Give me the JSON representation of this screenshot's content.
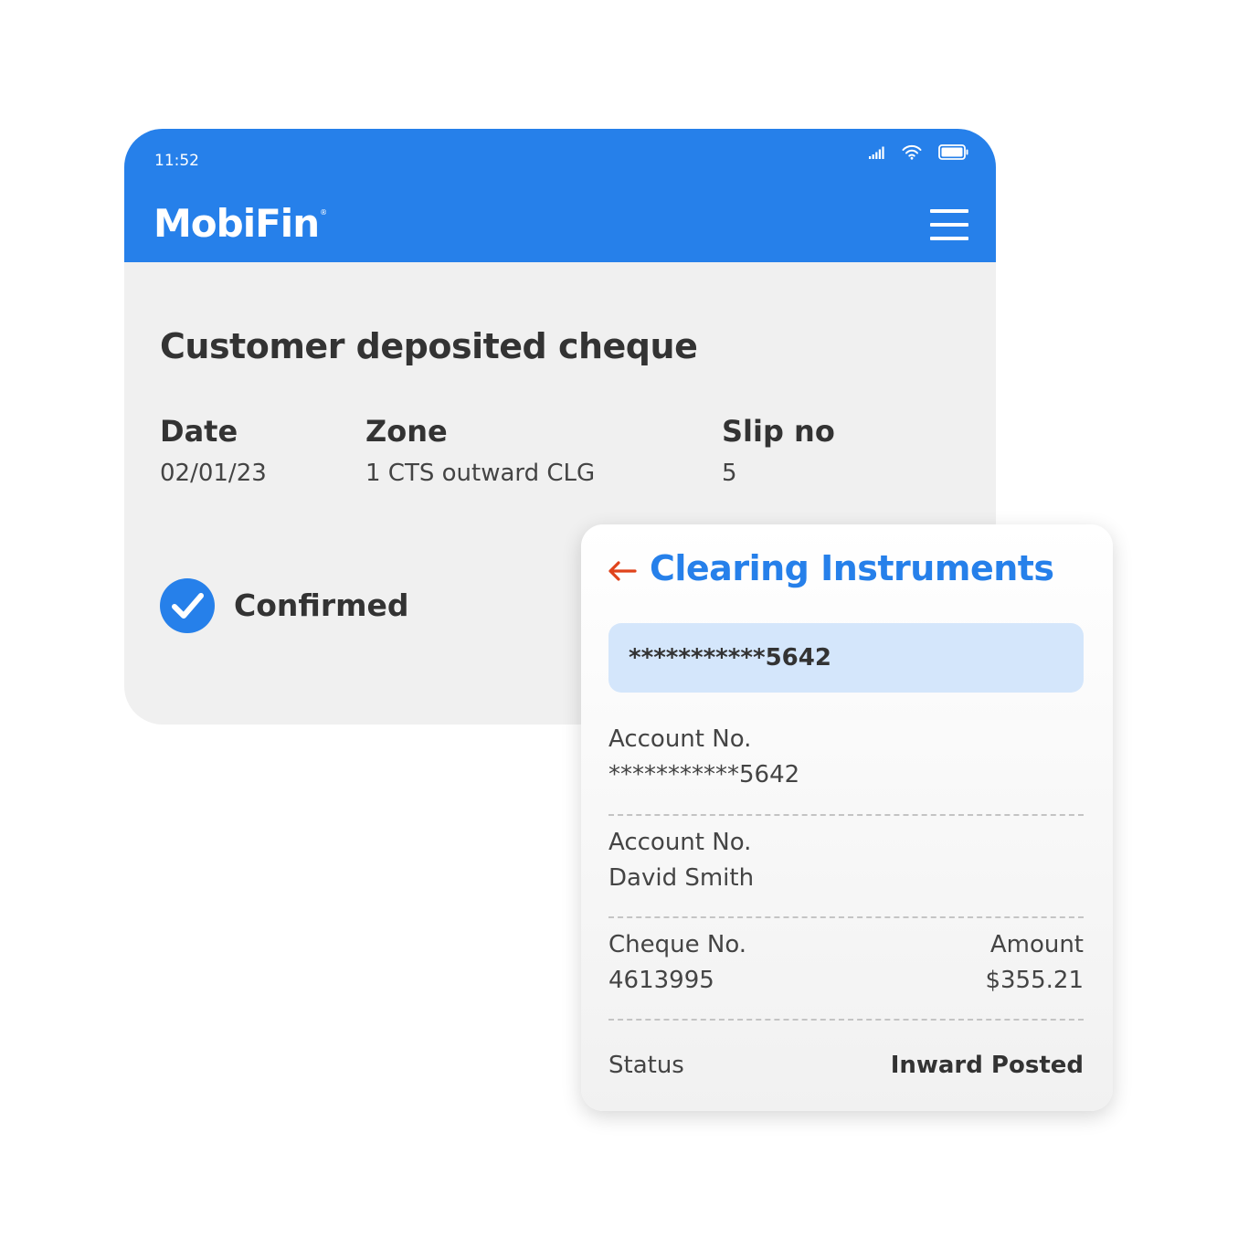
{
  "status_bar": {
    "time": "11:52",
    "icons": [
      "signal-icon",
      "wifi-icon",
      "battery-icon"
    ]
  },
  "app": {
    "brand": "MobiFin",
    "brand_mark": "®",
    "menu_icon": "hamburger-menu-icon"
  },
  "deposit_card": {
    "title": "Customer deposited cheque",
    "fields": [
      {
        "label": "Date",
        "value": "02/01/23"
      },
      {
        "label": "Zone",
        "value": "1 CTS outward CLG"
      },
      {
        "label": "Slip no",
        "value": "5"
      }
    ],
    "status_label": "Confirmed",
    "status_icon": "check-circle-icon"
  },
  "clearing": {
    "back_icon": "arrow-left-icon",
    "title": "Clearing Instruments",
    "account_search_value": "***********5642",
    "rows": [
      {
        "label": "Account No.",
        "value": "***********5642"
      },
      {
        "label": "Account No.",
        "value": "David Smith"
      }
    ],
    "cheque": {
      "label": "Cheque No.",
      "value": "4613995"
    },
    "amount": {
      "label": "Amount",
      "value": "$355.21"
    },
    "status": {
      "label": "Status",
      "value": "Inward Posted"
    }
  },
  "colors": {
    "brand_blue": "#2680ea",
    "card_grey": "#f0f0f0",
    "field_blue": "#d4e6fb",
    "back_arrow": "#e0431b",
    "text_dark": "#333333"
  }
}
